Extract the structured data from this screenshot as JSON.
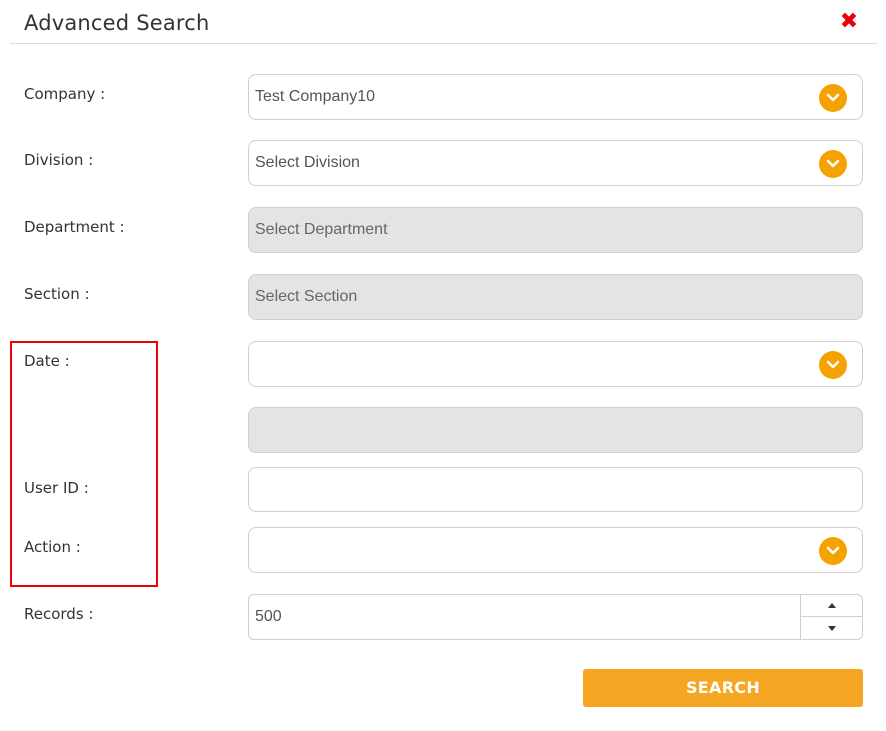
{
  "dialog": {
    "title": "Advanced Search",
    "close_icon": "close-icon",
    "close_glyph": "✖"
  },
  "form": {
    "company": {
      "label": "Company :",
      "value": "Test Company10"
    },
    "division": {
      "label": "Division :",
      "placeholder": "Select Division"
    },
    "department": {
      "label": "Department :",
      "placeholder": "Select Department"
    },
    "section": {
      "label": "Section :",
      "placeholder": "Select Section"
    },
    "date": {
      "label": "Date :",
      "value": ""
    },
    "date_range": {
      "value": ""
    },
    "user_id": {
      "label": "User ID :",
      "value": ""
    },
    "action": {
      "label": "Action :",
      "value": ""
    },
    "records": {
      "label": "Records :",
      "value": "500"
    }
  },
  "search_button": {
    "label": "SEARCH"
  },
  "colors": {
    "accent": "#f5a200",
    "button": "#f5a623",
    "highlight_border": "#e8000b",
    "disabled_field": "#e6e3e3"
  }
}
